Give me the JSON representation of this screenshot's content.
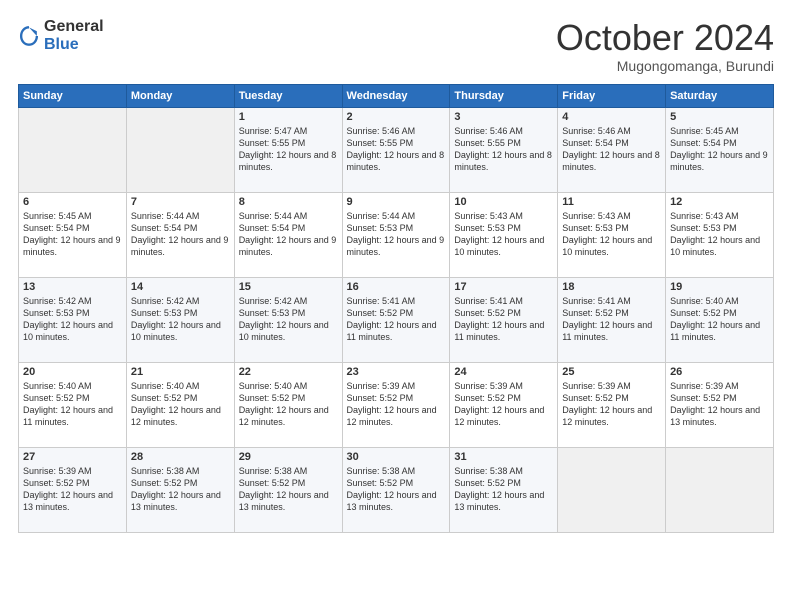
{
  "logo": {
    "general": "General",
    "blue": "Blue"
  },
  "title": "October 2024",
  "location": "Mugongomanga, Burundi",
  "days_header": [
    "Sunday",
    "Monday",
    "Tuesday",
    "Wednesday",
    "Thursday",
    "Friday",
    "Saturday"
  ],
  "weeks": [
    [
      {
        "num": "",
        "sunrise": "",
        "sunset": "",
        "daylight": ""
      },
      {
        "num": "",
        "sunrise": "",
        "sunset": "",
        "daylight": ""
      },
      {
        "num": "1",
        "sunrise": "Sunrise: 5:47 AM",
        "sunset": "Sunset: 5:55 PM",
        "daylight": "Daylight: 12 hours and 8 minutes."
      },
      {
        "num": "2",
        "sunrise": "Sunrise: 5:46 AM",
        "sunset": "Sunset: 5:55 PM",
        "daylight": "Daylight: 12 hours and 8 minutes."
      },
      {
        "num": "3",
        "sunrise": "Sunrise: 5:46 AM",
        "sunset": "Sunset: 5:55 PM",
        "daylight": "Daylight: 12 hours and 8 minutes."
      },
      {
        "num": "4",
        "sunrise": "Sunrise: 5:46 AM",
        "sunset": "Sunset: 5:54 PM",
        "daylight": "Daylight: 12 hours and 8 minutes."
      },
      {
        "num": "5",
        "sunrise": "Sunrise: 5:45 AM",
        "sunset": "Sunset: 5:54 PM",
        "daylight": "Daylight: 12 hours and 9 minutes."
      }
    ],
    [
      {
        "num": "6",
        "sunrise": "Sunrise: 5:45 AM",
        "sunset": "Sunset: 5:54 PM",
        "daylight": "Daylight: 12 hours and 9 minutes."
      },
      {
        "num": "7",
        "sunrise": "Sunrise: 5:44 AM",
        "sunset": "Sunset: 5:54 PM",
        "daylight": "Daylight: 12 hours and 9 minutes."
      },
      {
        "num": "8",
        "sunrise": "Sunrise: 5:44 AM",
        "sunset": "Sunset: 5:54 PM",
        "daylight": "Daylight: 12 hours and 9 minutes."
      },
      {
        "num": "9",
        "sunrise": "Sunrise: 5:44 AM",
        "sunset": "Sunset: 5:53 PM",
        "daylight": "Daylight: 12 hours and 9 minutes."
      },
      {
        "num": "10",
        "sunrise": "Sunrise: 5:43 AM",
        "sunset": "Sunset: 5:53 PM",
        "daylight": "Daylight: 12 hours and 10 minutes."
      },
      {
        "num": "11",
        "sunrise": "Sunrise: 5:43 AM",
        "sunset": "Sunset: 5:53 PM",
        "daylight": "Daylight: 12 hours and 10 minutes."
      },
      {
        "num": "12",
        "sunrise": "Sunrise: 5:43 AM",
        "sunset": "Sunset: 5:53 PM",
        "daylight": "Daylight: 12 hours and 10 minutes."
      }
    ],
    [
      {
        "num": "13",
        "sunrise": "Sunrise: 5:42 AM",
        "sunset": "Sunset: 5:53 PM",
        "daylight": "Daylight: 12 hours and 10 minutes."
      },
      {
        "num": "14",
        "sunrise": "Sunrise: 5:42 AM",
        "sunset": "Sunset: 5:53 PM",
        "daylight": "Daylight: 12 hours and 10 minutes."
      },
      {
        "num": "15",
        "sunrise": "Sunrise: 5:42 AM",
        "sunset": "Sunset: 5:53 PM",
        "daylight": "Daylight: 12 hours and 10 minutes."
      },
      {
        "num": "16",
        "sunrise": "Sunrise: 5:41 AM",
        "sunset": "Sunset: 5:52 PM",
        "daylight": "Daylight: 12 hours and 11 minutes."
      },
      {
        "num": "17",
        "sunrise": "Sunrise: 5:41 AM",
        "sunset": "Sunset: 5:52 PM",
        "daylight": "Daylight: 12 hours and 11 minutes."
      },
      {
        "num": "18",
        "sunrise": "Sunrise: 5:41 AM",
        "sunset": "Sunset: 5:52 PM",
        "daylight": "Daylight: 12 hours and 11 minutes."
      },
      {
        "num": "19",
        "sunrise": "Sunrise: 5:40 AM",
        "sunset": "Sunset: 5:52 PM",
        "daylight": "Daylight: 12 hours and 11 minutes."
      }
    ],
    [
      {
        "num": "20",
        "sunrise": "Sunrise: 5:40 AM",
        "sunset": "Sunset: 5:52 PM",
        "daylight": "Daylight: 12 hours and 11 minutes."
      },
      {
        "num": "21",
        "sunrise": "Sunrise: 5:40 AM",
        "sunset": "Sunset: 5:52 PM",
        "daylight": "Daylight: 12 hours and 12 minutes."
      },
      {
        "num": "22",
        "sunrise": "Sunrise: 5:40 AM",
        "sunset": "Sunset: 5:52 PM",
        "daylight": "Daylight: 12 hours and 12 minutes."
      },
      {
        "num": "23",
        "sunrise": "Sunrise: 5:39 AM",
        "sunset": "Sunset: 5:52 PM",
        "daylight": "Daylight: 12 hours and 12 minutes."
      },
      {
        "num": "24",
        "sunrise": "Sunrise: 5:39 AM",
        "sunset": "Sunset: 5:52 PM",
        "daylight": "Daylight: 12 hours and 12 minutes."
      },
      {
        "num": "25",
        "sunrise": "Sunrise: 5:39 AM",
        "sunset": "Sunset: 5:52 PM",
        "daylight": "Daylight: 12 hours and 12 minutes."
      },
      {
        "num": "26",
        "sunrise": "Sunrise: 5:39 AM",
        "sunset": "Sunset: 5:52 PM",
        "daylight": "Daylight: 12 hours and 13 minutes."
      }
    ],
    [
      {
        "num": "27",
        "sunrise": "Sunrise: 5:39 AM",
        "sunset": "Sunset: 5:52 PM",
        "daylight": "Daylight: 12 hours and 13 minutes."
      },
      {
        "num": "28",
        "sunrise": "Sunrise: 5:38 AM",
        "sunset": "Sunset: 5:52 PM",
        "daylight": "Daylight: 12 hours and 13 minutes."
      },
      {
        "num": "29",
        "sunrise": "Sunrise: 5:38 AM",
        "sunset": "Sunset: 5:52 PM",
        "daylight": "Daylight: 12 hours and 13 minutes."
      },
      {
        "num": "30",
        "sunrise": "Sunrise: 5:38 AM",
        "sunset": "Sunset: 5:52 PM",
        "daylight": "Daylight: 12 hours and 13 minutes."
      },
      {
        "num": "31",
        "sunrise": "Sunrise: 5:38 AM",
        "sunset": "Sunset: 5:52 PM",
        "daylight": "Daylight: 12 hours and 13 minutes."
      },
      {
        "num": "",
        "sunrise": "",
        "sunset": "",
        "daylight": ""
      },
      {
        "num": "",
        "sunrise": "",
        "sunset": "",
        "daylight": ""
      }
    ]
  ]
}
